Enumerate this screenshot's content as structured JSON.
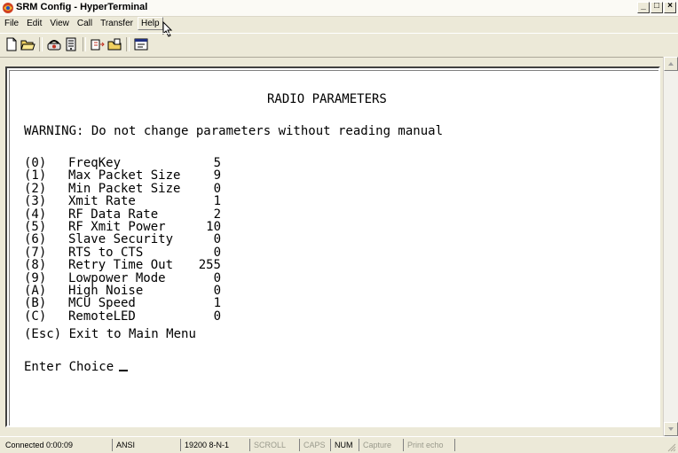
{
  "window": {
    "title": "SRM Config - HyperTerminal",
    "controls": {
      "minimize": "_",
      "maximize": "□",
      "close": "×"
    }
  },
  "menu": [
    "File",
    "Edit",
    "View",
    "Call",
    "Transfer",
    "Help"
  ],
  "toolbar": {
    "icons": [
      "new-icon",
      "open-icon",
      "call-icon",
      "disconnect-icon",
      "send-icon",
      "receive-icon",
      "properties-icon"
    ]
  },
  "terminal": {
    "heading": "RADIO PARAMETERS",
    "warning": "WARNING: Do not change parameters without reading manual",
    "params": [
      {
        "key": "(0)",
        "label": "FreqKey",
        "value": "5"
      },
      {
        "key": "(1)",
        "label": "Max Packet Size",
        "value": "9"
      },
      {
        "key": "(2)",
        "label": "Min Packet Size",
        "value": "0"
      },
      {
        "key": "(3)",
        "label": "Xmit Rate",
        "value": "1"
      },
      {
        "key": "(4)",
        "label": "RF Data Rate",
        "value": "2"
      },
      {
        "key": "(5)",
        "label": "RF Xmit Power",
        "value": "10"
      },
      {
        "key": "(6)",
        "label": "Slave Security",
        "value": "0"
      },
      {
        "key": "(7)",
        "label": "RTS to CTS",
        "value": "0"
      },
      {
        "key": "(8)",
        "label": "Retry Time Out",
        "value": "255"
      },
      {
        "key": "(9)",
        "label": "Lowpower Mode",
        "value": "0"
      },
      {
        "key": "(A)",
        "label": "High Noise",
        "value": "0"
      },
      {
        "key": "(B)",
        "label": "MCU Speed",
        "value": "1"
      },
      {
        "key": "(C)",
        "label": "RemoteLED",
        "value": "0"
      }
    ],
    "exit_key": "(Esc)",
    "exit_label": "Exit to Main Menu",
    "prompt": "Enter Choice"
  },
  "status": {
    "connected": "Connected 0:00:09",
    "emulation": "ANSI",
    "settings": "19200 8-N-1",
    "scroll": "SCROLL",
    "caps": "CAPS",
    "num": "NUM",
    "capture": "Capture",
    "print_echo": "Print echo"
  }
}
